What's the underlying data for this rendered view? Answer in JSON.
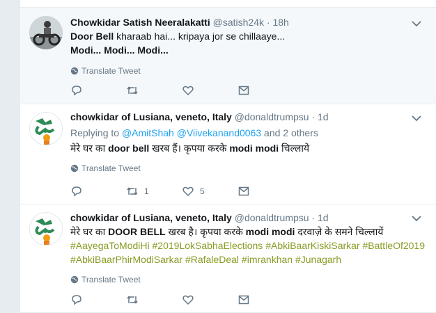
{
  "tweets": [
    {
      "name": "Chowkidar Satish Neeralakatti",
      "handle": "@satish24k",
      "dot": "·",
      "time": "18h",
      "line1_bold": "Door Bell",
      "line1_rest": " kharaab hai... kripaya jor se chillaaye...",
      "line2": "Modi... Modi... Modi...",
      "translate": "Translate Tweet"
    },
    {
      "name": "chowkidar of Lusiana, veneto, Italy",
      "handle": "@donaldtrumpsu",
      "dot": "·",
      "time": "1d",
      "replying_prefix": "Replying to ",
      "replying_user1": "@AmitShah",
      "replying_user2": "@Viivekanand0063",
      "replying_suffix": " and 2 others",
      "text_part1": "मेरे घर का ",
      "text_bold1": "door bell",
      "text_part2": " खरब हैं। कृपया करके ",
      "text_bold2": "modi modi",
      "text_part3": " चिल्लाये",
      "translate": "Translate Tweet",
      "retweets": "1",
      "likes": "5"
    },
    {
      "name": "chowkidar of Lusiana, veneto, Italy",
      "handle": "@donaldtrumpsu",
      "dot": "·",
      "time": "1d",
      "text_part1": "मेरे घर का ",
      "text_bold1": "DOOR BELL",
      "text_part2": " खरब है। कृपया करके ",
      "text_bold2": "modi modi",
      "text_part3": " दरवाज़े के समने चिल्लायें",
      "hashtags_line1": [
        "#AayegaToModiHi",
        "#2019LokSabhaElections",
        "#AbkiBaarKiskiSarkar",
        "#BattleOf2019"
      ],
      "hashtags_line2": [
        "#AbkiBaarPhirModiSarkar",
        "#RafaleDeal",
        "#imrankhan",
        "#Junagarh"
      ],
      "translate": "Translate Tweet"
    }
  ],
  "colors": {
    "link": "#1da1f2",
    "hashtag": "#8a9a24",
    "muted": "#657786"
  },
  "icons": [
    "globe-icon",
    "reply-icon",
    "retweet-icon",
    "like-icon",
    "message-icon",
    "chevron-down-icon"
  ]
}
